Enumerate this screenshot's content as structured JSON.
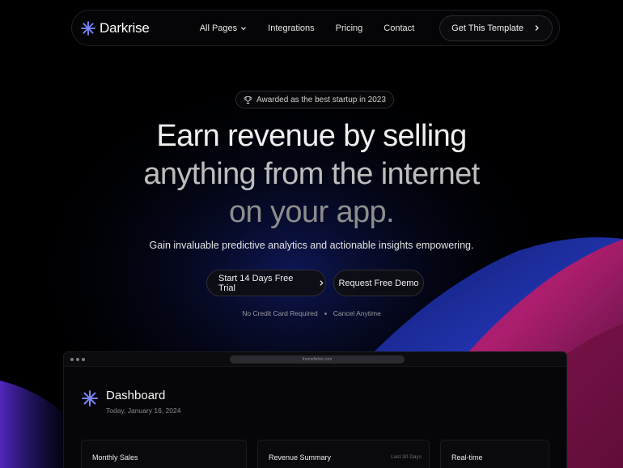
{
  "nav": {
    "brand": "Darkrise",
    "links": [
      "All Pages",
      "Integrations",
      "Pricing",
      "Contact"
    ],
    "cta": "Get This Template"
  },
  "hero": {
    "award": "Awarded as the best startup in 2023",
    "headline": [
      "Earn revenue by selling",
      "anything from the internet",
      "on your app."
    ],
    "subtitle": "Gain invaluable predictive analytics and actionable insights empowering.",
    "primary_button": "Start 14 Days Free Trial",
    "secondary_button": "Request Free Demo",
    "notes": [
      "No Credit Card Required",
      "Cancel Anytime"
    ]
  },
  "dashboard": {
    "url": "themefisher.com",
    "title": "Dashboard",
    "date": "Today, January 16, 2024",
    "cards": [
      {
        "title": "Monthly Sales",
        "meta": ""
      },
      {
        "title": "Revenue Summary",
        "meta": "Last 30 Days"
      },
      {
        "title": "Real-time",
        "meta": ""
      }
    ]
  },
  "colors": {
    "background": "#000000",
    "accent_blue": "#6f7dff",
    "swoosh_magenta": "#c2206e",
    "swoosh_blue": "#2c3fd6"
  },
  "icons": [
    "asterisk-logo-icon",
    "chevron-down-icon",
    "chevron-right-icon",
    "trophy-icon"
  ]
}
